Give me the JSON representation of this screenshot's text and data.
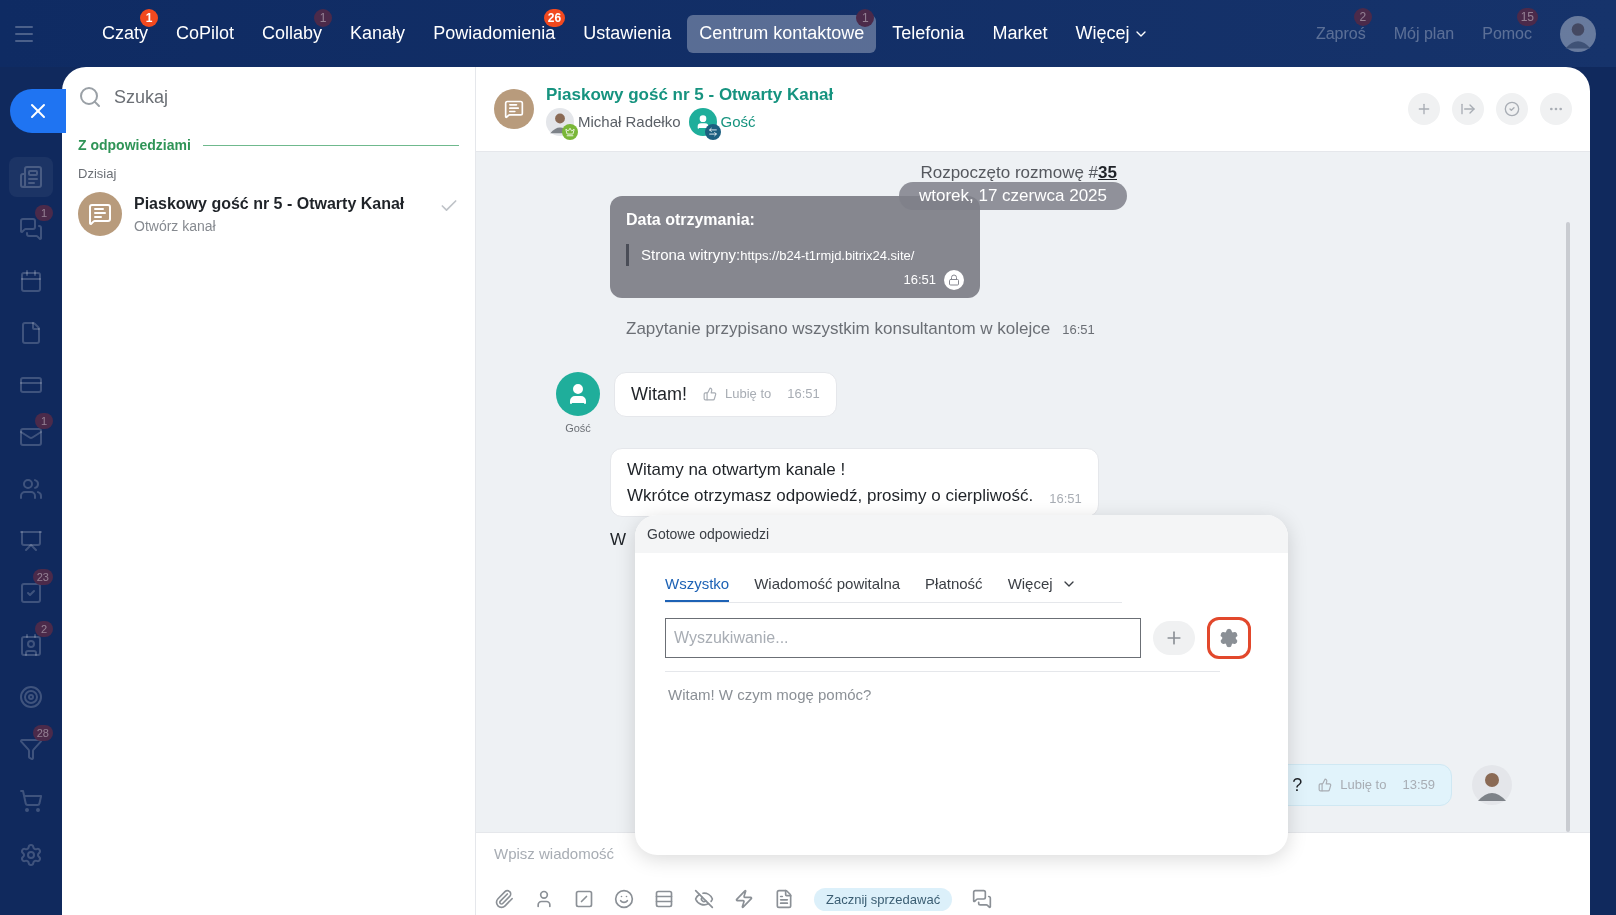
{
  "top_nav": {
    "items": [
      {
        "label": "Czaty",
        "selected": false,
        "badge": {
          "text": "1",
          "faded": false
        }
      },
      {
        "label": "CoPilot",
        "selected": false
      },
      {
        "label": "Collaby",
        "selected": false,
        "badge": {
          "text": "1",
          "faded": true
        }
      },
      {
        "label": "Kanały",
        "selected": false
      },
      {
        "label": "Powiadomienia",
        "selected": false,
        "badge": {
          "text": "26",
          "faded": false
        }
      },
      {
        "label": "Ustawienia",
        "selected": false
      },
      {
        "label": "Centrum kontaktowe",
        "selected": true,
        "badge": {
          "text": "1",
          "faded": true
        }
      },
      {
        "label": "Telefonia",
        "selected": false
      },
      {
        "label": "Market",
        "selected": false
      },
      {
        "label": "Więcej",
        "selected": false,
        "caret": true
      }
    ],
    "right_items": [
      {
        "label": "Zaproś",
        "badge": "2"
      },
      {
        "label": "Mój plan"
      },
      {
        "label": "Pomoc",
        "badge": "15"
      }
    ]
  },
  "rail": {
    "items": [
      {
        "active": true
      },
      {
        "active": false,
        "badge": "1"
      },
      {
        "active": false
      },
      {
        "active": false
      },
      {
        "active": false
      },
      {
        "active": false,
        "badge": "1"
      },
      {
        "active": false
      },
      {
        "active": false
      },
      {
        "active": false,
        "badge": "23"
      },
      {
        "active": false,
        "badge": "2"
      },
      {
        "active": false
      },
      {
        "active": false,
        "badge": "28"
      },
      {
        "active": false
      }
    ]
  },
  "sidebar": {
    "search": {
      "placeholder": "Szukaj"
    },
    "section": "Z odpowiedziami",
    "group": "Dzisiaj",
    "chats": [
      {
        "title": "Piaskowy gość nr 5 - Otwarty Kanał",
        "subtitle": "Otwórz kanał",
        "read": true
      }
    ]
  },
  "chat": {
    "title": "Piaskowy gość nr 5 - Otwarty Kanał",
    "members": [
      {
        "name": "Michał Radełko",
        "kind": "operator"
      },
      {
        "name": "Gość",
        "kind": "guest"
      }
    ],
    "start_notice": {
      "text": "Rozpoczęto rozmowę #",
      "link": "35"
    },
    "date": "wtorek, 17 czerwca 2025",
    "messages": [
      {
        "kind": "form",
        "title": "Data otrzymania:",
        "label": "Strona witryny:",
        "link": "https://b24-t1rmjd.bitrix24.site/",
        "time": "16:51"
      },
      {
        "kind": "system",
        "text": "Zapytanie przypisano wszystkim konsultantom w kolejce",
        "time": "16:51"
      },
      {
        "kind": "guest",
        "author": "Gość",
        "text": "Witam!",
        "like": "Lubię to",
        "time": "16:51"
      },
      {
        "kind": "bot",
        "lines": [
          "Witamy na otwartym kanale !",
          "Wkrótce otrzymasz odpowiedź, prosimy o cierpliwość."
        ],
        "time": "16:51"
      },
      {
        "kind": "partial",
        "text": "W"
      },
      {
        "kind": "own",
        "text": "?",
        "like": "Lubię to",
        "time": "13:59"
      }
    ],
    "composer": {
      "placeholder": "Wpisz wiadomość",
      "sell_button": "Zacznij sprzedawać"
    }
  },
  "quick_answers": {
    "title": "Gotowe odpowiedzi",
    "tabs": [
      {
        "label": "Wszystko",
        "selected": true
      },
      {
        "label": "Wiadomość powitalna",
        "selected": false
      },
      {
        "label": "Płatność",
        "selected": false
      },
      {
        "label": "Więcej",
        "selected": false,
        "caret": true
      }
    ],
    "search": {
      "placeholder": "Wyszukiwanie..."
    },
    "settings_highlighted": true,
    "answers": [
      "Witam! W czym mogę pomóc?"
    ]
  }
}
